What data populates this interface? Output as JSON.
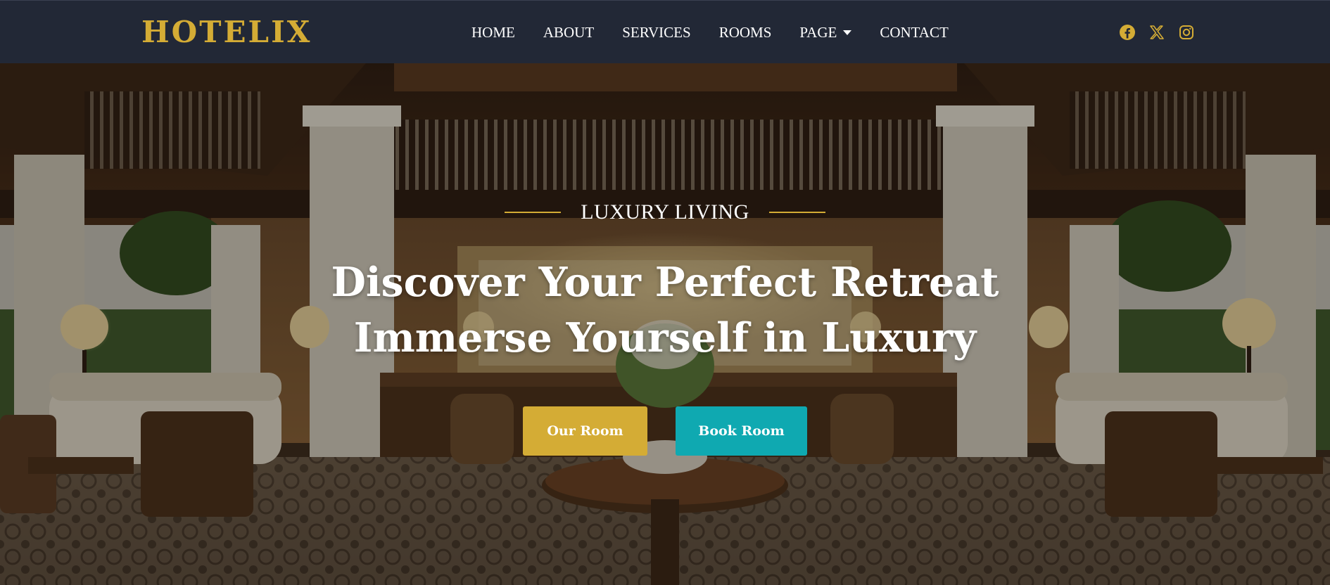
{
  "brand": {
    "logo": "HOTELIX",
    "accent_color": "#d4ac35"
  },
  "nav": {
    "items": [
      {
        "label": "HOME"
      },
      {
        "label": "ABOUT"
      },
      {
        "label": "SERVICES"
      },
      {
        "label": "ROOMS"
      },
      {
        "label": "PAGE",
        "has_dropdown": true
      },
      {
        "label": "CONTACT"
      }
    ]
  },
  "social": [
    {
      "icon": "facebook-icon"
    },
    {
      "icon": "x-twitter-icon"
    },
    {
      "icon": "instagram-icon"
    }
  ],
  "hero": {
    "subtitle": "LUXURY LIVING",
    "headline_line1": "Discover Your Perfect Retreat",
    "headline_line2": "Immerse Yourself in Luxury",
    "buttons": {
      "our_room": "Our Room",
      "book_room": "Book Room"
    },
    "button_colors": {
      "our_room": "#d4ac35",
      "book_room": "#0fa9b1"
    },
    "background": "hotel-lobby-photo"
  }
}
